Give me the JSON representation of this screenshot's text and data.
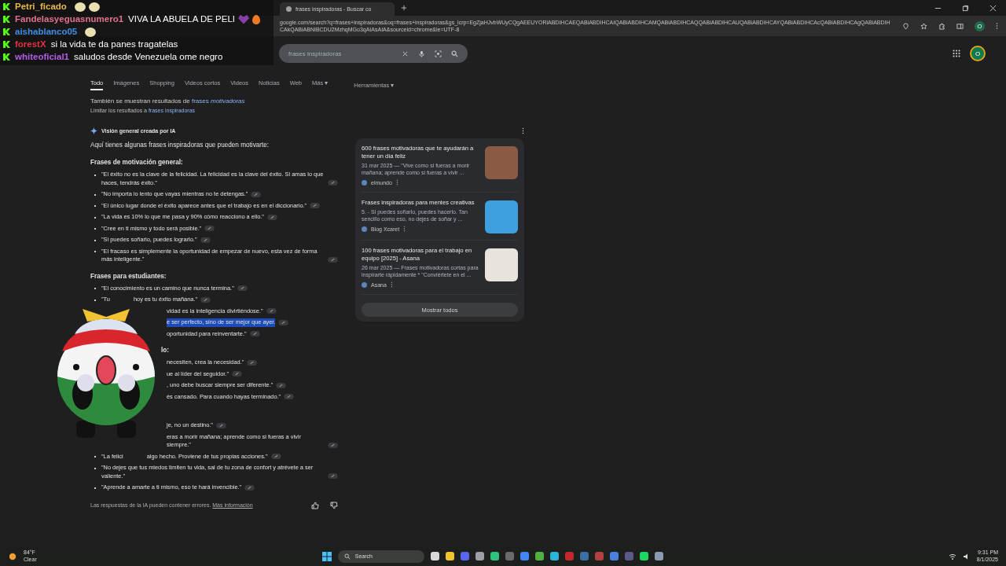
{
  "chat": [
    {
      "user": "Petri_ficado",
      "color": "#e9b949",
      "emotes": [
        {
          "kind": "sticker"
        },
        {
          "kind": "sticker"
        }
      ]
    },
    {
      "user": "Fandelasyeguasnumero1",
      "color": "#e0708e",
      "message": "VIVA LA ABUELA DE PELI",
      "emotes": [
        {
          "kind": "heart"
        },
        {
          "kind": "fire"
        }
      ]
    },
    {
      "user": "aishablanco05",
      "color": "#3d8fe6",
      "emotes": [
        {
          "kind": "sticker"
        }
      ]
    },
    {
      "user": "forestX",
      "color": "#e2333f",
      "message": "si la vida te da panes tragatelas"
    },
    {
      "user": "whiteoficial1",
      "color": "#b35ee6",
      "message": "saludos desde Venezuela ome negro"
    }
  ],
  "browser": {
    "tab_title": "frases inspiradoras - Buscar co",
    "url": "google.com/search?q=frases+inspiradoras&oq=frases+inspiradoras&gs_lcrp=EgZjaHJvbWUyCQgAEEUYORiABDIHCAEQABiABDIHCAIQABiABDIHCAMQABiABDIHCAQQABiABDIHCAUQABiABDIHCAYQABiABDIHCAcQABiABDIHCAgQABiABDIHCAkQABiABNIBCDU2MzhqMGo3qAIAsAIA&sourceid=chrome&ie=UTF-8",
    "profile": "O"
  },
  "search": {
    "value": "frases inspiradoras",
    "avatar": "O"
  },
  "nav": [
    {
      "label": "Todo",
      "selected": true
    },
    {
      "label": "Imágenes",
      "selected": false
    },
    {
      "label": "Shopping",
      "selected": false
    },
    {
      "label": "Videos cortos",
      "selected": false
    },
    {
      "label": "Videos",
      "selected": false
    },
    {
      "label": "Noticias",
      "selected": false
    },
    {
      "label": "Web",
      "selected": false
    },
    {
      "label": "Más ▾",
      "selected": false
    }
  ],
  "tools": "Herramientas ▾",
  "notice": {
    "prefix": "También se muestran resultados de",
    "link": "frases *motivadoras*",
    "limit_prefix": "Limitar los resultados a",
    "limit_link": "frases inspiradoras"
  },
  "ai": {
    "title": "Visión general creada por IA",
    "intro": "Aquí tienes algunas frases inspiradoras que pueden motivarte:",
    "sections": [
      {
        "heading": "Frases de motivación general:",
        "items": [
          {
            "kind": "full",
            "text": "\"El éxito no es la clave de la felicidad. La felicidad es la clave del éxito. Si amas lo que haces, tendrás éxito.\"",
            "highlighted": false
          },
          {
            "kind": "full",
            "text": "\"No importa lo lento que vayas mientras no te detengas.\"",
            "highlighted": false
          },
          {
            "kind": "full",
            "text": "\"El único lugar donde el éxito aparece antes que el trabajo es en el diccionario.\"",
            "highlighted": false
          },
          {
            "kind": "full",
            "text": "\"La vida es 10% lo que me pasa y 90% cómo reacciono a ello.\"",
            "highlighted": false
          },
          {
            "kind": "full",
            "text": "\"Cree en ti mismo y todo será posible.\"",
            "highlighted": false
          },
          {
            "kind": "full",
            "text": "\"Si puedes soñarlo, puedes lograrlo.\"",
            "highlighted": false
          },
          {
            "kind": "full",
            "text": "\"El fracaso es simplemente la oportunidad de empezar de nuevo, esta vez de forma más inteligente.\"",
            "highlighted": false
          }
        ]
      },
      {
        "heading": "Frases para estudiantes:",
        "partial": false,
        "items": [
          {
            "kind": "full",
            "text": "\"El conocimiento es un camino que nunca termina.\"",
            "highlighted": false
          },
          {
            "kind": "full",
            "lead": "\"Tu",
            "text": "hoy es tu éxito mañana.\"",
            "highlighted": false
          },
          {
            "kind": "partial",
            "text": "vidad es la inteligencia divirtiéndose.\"",
            "highlighted": false
          },
          {
            "kind": "partial",
            "text": "e ser perfecto, sino de ser mejor que ayer.",
            "highlighted": true
          },
          {
            "kind": "partial",
            "text": "oportunidad para reinventarte.\"",
            "highlighted": false
          }
        ]
      },
      {
        "heading": "lo:",
        "partial": true,
        "items": [
          {
            "kind": "partial",
            "text": "necesiten, crea la necesidad.\"",
            "highlighted": false
          },
          {
            "kind": "partial",
            "text": "ue al líder del seguidor.\"",
            "highlighted": false
          },
          {
            "kind": "partial",
            "text": ", uno debe buscar siempre ser diferente.\"",
            "highlighted": false
          },
          {
            "kind": "partial",
            "text": "és cansado. Para cuando hayas terminado.\"",
            "highlighted": false
          }
        ]
      },
      {
        "items": [
          {
            "kind": "partial",
            "text": "je, no un destino.\"",
            "highlighted": false
          },
          {
            "kind": "partial",
            "text": "eras a morir mañana; aprende como si fueras a vivir siempre.\"",
            "highlighted": false
          },
          {
            "kind": "full",
            "lead": "\"La felici",
            "text": "algo hecho. Proviene de tus propias acciones.\"",
            "highlighted": false
          },
          {
            "kind": "full",
            "text": "\"No dejes que tus miedos limiten tu vida, sal de tu zona de confort y atrévete a ser valiente.\"",
            "highlighted": false
          },
          {
            "kind": "full",
            "text": "\"Aprende a amarte a ti mismo, eso te hará invencible.\"",
            "highlighted": false
          }
        ]
      }
    ],
    "disclaimer": "Las respuestas de la IA pueden contener errores.",
    "more_link": "Más información"
  },
  "sources": [
    {
      "title": "600 frases motivadoras que te ayudarán a tener un día feliz",
      "snippet": "31 mar 2025 — \"Vive como si fueras a morir mañana; aprende como si fueras a vivir ...",
      "site": "elmundo"
    },
    {
      "title": "Frases inspiradoras para mentes creativas",
      "snippet": "5. - Si puedes soñarlo, puedes hacerlo. Tan sencillo como eso, no dejes de soñar y ...",
      "site": "Blog Xcaret"
    },
    {
      "title": "100 frases motivadoras para el trabajo en equipo [2025] - Asana",
      "snippet": "26 mar 2025 — Frases motivadoras cortas para inspirarte rápidamente * \"Conviértete en el ...",
      "site": "Asana"
    }
  ],
  "show_all": "Mostrar todos",
  "taskbar": {
    "temp": "84°F",
    "weather": "Clear",
    "search": "Search",
    "time": "9:31 PM",
    "date": "8/1/2025"
  }
}
